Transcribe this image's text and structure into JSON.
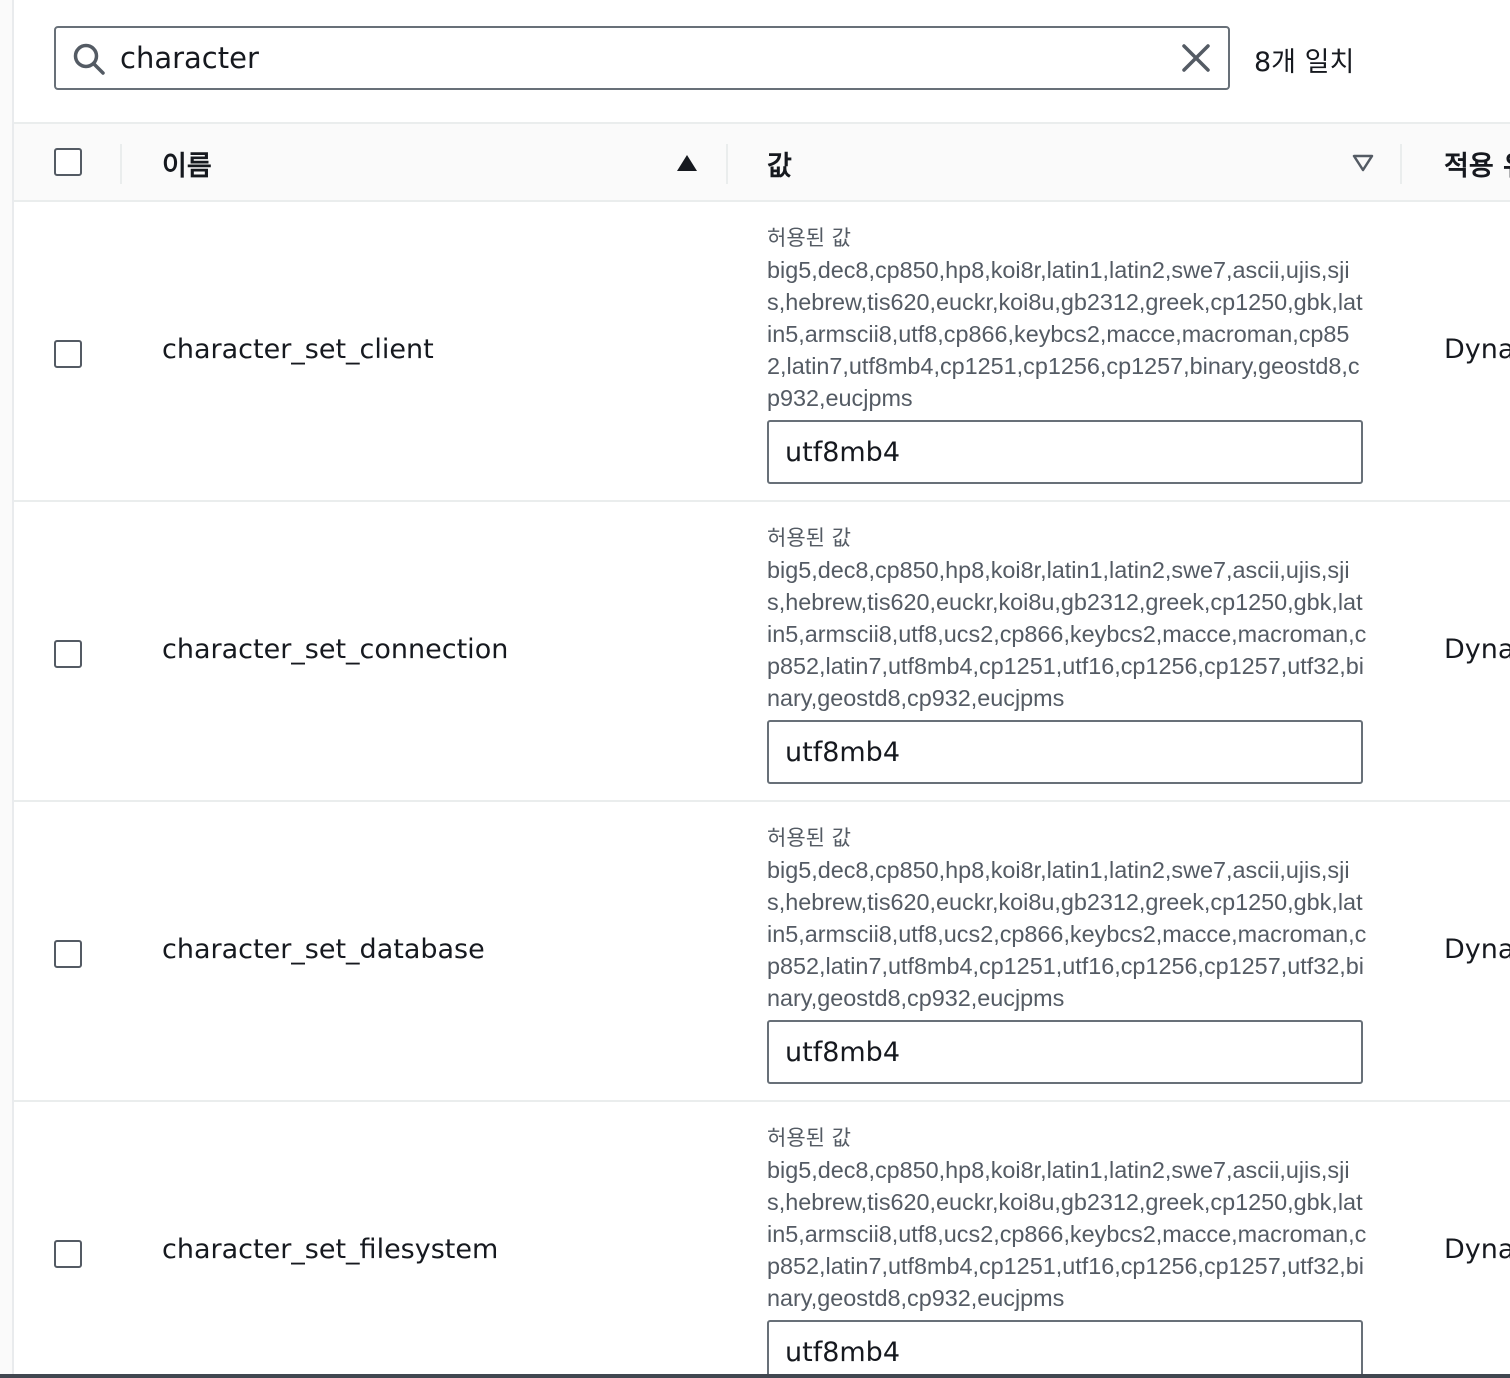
{
  "search": {
    "value": "character",
    "match_count": "8개 일치"
  },
  "table": {
    "headers": {
      "name": "이름",
      "value": "값",
      "apply_type": "적용 유"
    },
    "rows": [
      {
        "name": "character_set_client",
        "allowed_label": "허용된 값",
        "allowed_values": "big5,dec8,cp850,hp8,koi8r,latin1,latin2,swe7,ascii,ujis,sjis,hebrew,tis620,euckr,koi8u,gb2312,greek,cp1250,gbk,latin5,armscii8,utf8,cp866,keybcs2,macce,macroman,cp852,latin7,utf8mb4,cp1251,cp1256,cp1257,binary,geostd8,cp932,eucjpms",
        "value": "utf8mb4",
        "apply_type": "Dyna"
      },
      {
        "name": "character_set_connection",
        "allowed_label": "허용된 값",
        "allowed_values": "big5,dec8,cp850,hp8,koi8r,latin1,latin2,swe7,ascii,ujis,sjis,hebrew,tis620,euckr,koi8u,gb2312,greek,cp1250,gbk,latin5,armscii8,utf8,ucs2,cp866,keybcs2,macce,macroman,cp852,latin7,utf8mb4,cp1251,utf16,cp1256,cp1257,utf32,binary,geostd8,cp932,eucjpms",
        "value": "utf8mb4",
        "apply_type": "Dyna"
      },
      {
        "name": "character_set_database",
        "allowed_label": "허용된 값",
        "allowed_values": "big5,dec8,cp850,hp8,koi8r,latin1,latin2,swe7,ascii,ujis,sjis,hebrew,tis620,euckr,koi8u,gb2312,greek,cp1250,gbk,latin5,armscii8,utf8,ucs2,cp866,keybcs2,macce,macroman,cp852,latin7,utf8mb4,cp1251,utf16,cp1256,cp1257,utf32,binary,geostd8,cp932,eucjpms",
        "value": "utf8mb4",
        "apply_type": "Dyna"
      },
      {
        "name": "character_set_filesystem",
        "allowed_label": "허용된 값",
        "allowed_values": "big5,dec8,cp850,hp8,koi8r,latin1,latin2,swe7,ascii,ujis,sjis,hebrew,tis620,euckr,koi8u,gb2312,greek,cp1250,gbk,latin5,armscii8,utf8,ucs2,cp866,keybcs2,macce,macroman,cp852,latin7,utf8mb4,cp1251,utf16,cp1256,cp1257,utf32,binary,geostd8,cp932,eucjpms",
        "value": "utf8mb4",
        "apply_type": "Dyna"
      }
    ]
  },
  "icons": {
    "search": "search-icon",
    "clear": "close-icon",
    "sort_asc": "sort-ascending-icon",
    "sort_desc": "sort-descending-icon"
  }
}
